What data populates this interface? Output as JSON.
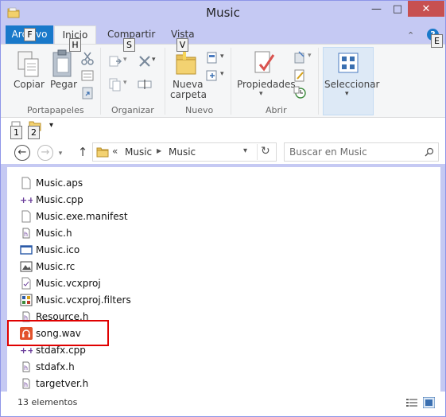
{
  "window": {
    "title": "Music"
  },
  "window_controls": {
    "minimize": "—",
    "maximize": "□",
    "close": "✕"
  },
  "tabs": {
    "archivo": "Archivo",
    "inicio": "Inicio",
    "compartir": "Compartir",
    "vista": "Vista"
  },
  "keytips": {
    "archivo": "F",
    "inicio": "H",
    "compartir": "S",
    "vista": "V",
    "help": "E",
    "qat_1": "1",
    "qat_2": "2"
  },
  "ribbon": {
    "copiar": "Copiar",
    "pegar": "Pegar",
    "nueva_carpeta_line1": "Nueva",
    "nueva_carpeta_line2": "carpeta",
    "propiedades": "Propiedades",
    "seleccionar": "Seleccionar",
    "groups": {
      "portapapeles": "Portapapeles",
      "organizar": "Organizar",
      "nuevo": "Nuevo",
      "abrir": "Abrir"
    }
  },
  "address": {
    "prefix": "«",
    "segments": [
      "Music",
      "Music"
    ]
  },
  "search": {
    "placeholder": "Buscar en Music"
  },
  "files": [
    {
      "name": "Music.aps",
      "icon": "generic-file-icon"
    },
    {
      "name": "Music.cpp",
      "icon": "cpp-file-icon"
    },
    {
      "name": "Music.exe.manifest",
      "icon": "generic-file-icon"
    },
    {
      "name": "Music.h",
      "icon": "header-file-icon"
    },
    {
      "name": "Music.ico",
      "icon": "ico-file-icon"
    },
    {
      "name": "Music.rc",
      "icon": "rc-file-icon"
    },
    {
      "name": "Music.vcxproj",
      "icon": "vcxproj-file-icon"
    },
    {
      "name": "Music.vcxproj.filters",
      "icon": "filters-file-icon"
    },
    {
      "name": "Resource.h",
      "icon": "header-file-icon"
    },
    {
      "name": "song.wav",
      "icon": "audio-file-icon"
    },
    {
      "name": "stdafx.cpp",
      "icon": "cpp-file-icon"
    },
    {
      "name": "stdafx.h",
      "icon": "header-file-icon"
    },
    {
      "name": "targetver.h",
      "icon": "header-file-icon"
    }
  ],
  "status": {
    "count": "13 elementos"
  },
  "colors": {
    "titlebar": "#c5c9f3",
    "file_tab": "#1979ca",
    "close_button": "#c75050",
    "highlight": "#e00000"
  }
}
